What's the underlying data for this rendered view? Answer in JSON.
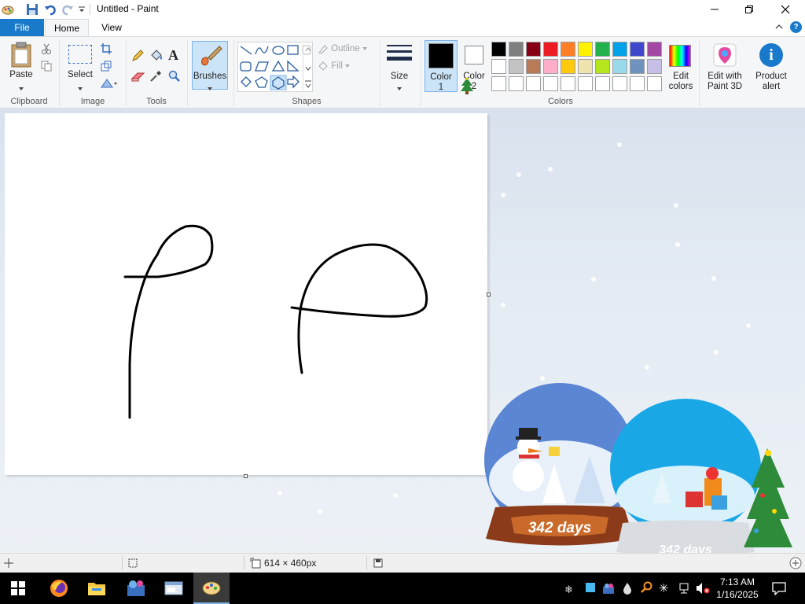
{
  "window": {
    "title": "Untitled - Paint"
  },
  "tabs": [
    {
      "label": "File"
    },
    {
      "label": "Home"
    },
    {
      "label": "View"
    }
  ],
  "ribbon": {
    "clipboard": {
      "paste_label": "Paste",
      "group_label": "Clipboard"
    },
    "image": {
      "select_label": "Select",
      "group_label": "Image"
    },
    "tools": {
      "group_label": "Tools",
      "text_glyph": "A"
    },
    "brushes": {
      "label": "Brushes"
    },
    "shapes": {
      "outline_label": "Outline",
      "fill_label": "Fill",
      "group_label": "Shapes"
    },
    "size": {
      "label": "Size"
    },
    "colors": {
      "color1_label": "Color",
      "color1_num": "1",
      "color2_label": "Color",
      "color2_num": "2",
      "group_label": "Colors",
      "edit_label_1": "Edit",
      "edit_label_2": "colors",
      "paint3d_label_1": "Edit with",
      "paint3d_label_2": "Paint 3D",
      "alert_label_1": "Product",
      "alert_label_2": "alert",
      "color1_value": "#000000",
      "color2_value": "#ffffff",
      "palette_row1": [
        "#000000",
        "#7f7f7f",
        "#880015",
        "#ed1c24",
        "#ff7f27",
        "#fff200",
        "#22b14c",
        "#00a2e8",
        "#3f48cc",
        "#a349a4"
      ],
      "palette_row2": [
        "#ffffff",
        "#c3c3c3",
        "#b97a57",
        "#ffaec9",
        "#ffc90e",
        "#efe4b0",
        "#b5e61d",
        "#99d9ea",
        "#7092be",
        "#c8bfe7"
      ],
      "palette_row3": [
        "#ffffff",
        "#ffffff",
        "#ffffff",
        "#ffffff",
        "#ffffff",
        "#ffffff",
        "#ffffff",
        "#ffffff",
        "#ffffff",
        "#ffffff"
      ]
    }
  },
  "status": {
    "canvas_size": "614 × 460px"
  },
  "desktop": {
    "globe_text_1": "342 days",
    "globe_text_2": "342 days"
  },
  "taskbar": {
    "time": "7:13 AM",
    "date": "1/16/2025"
  }
}
